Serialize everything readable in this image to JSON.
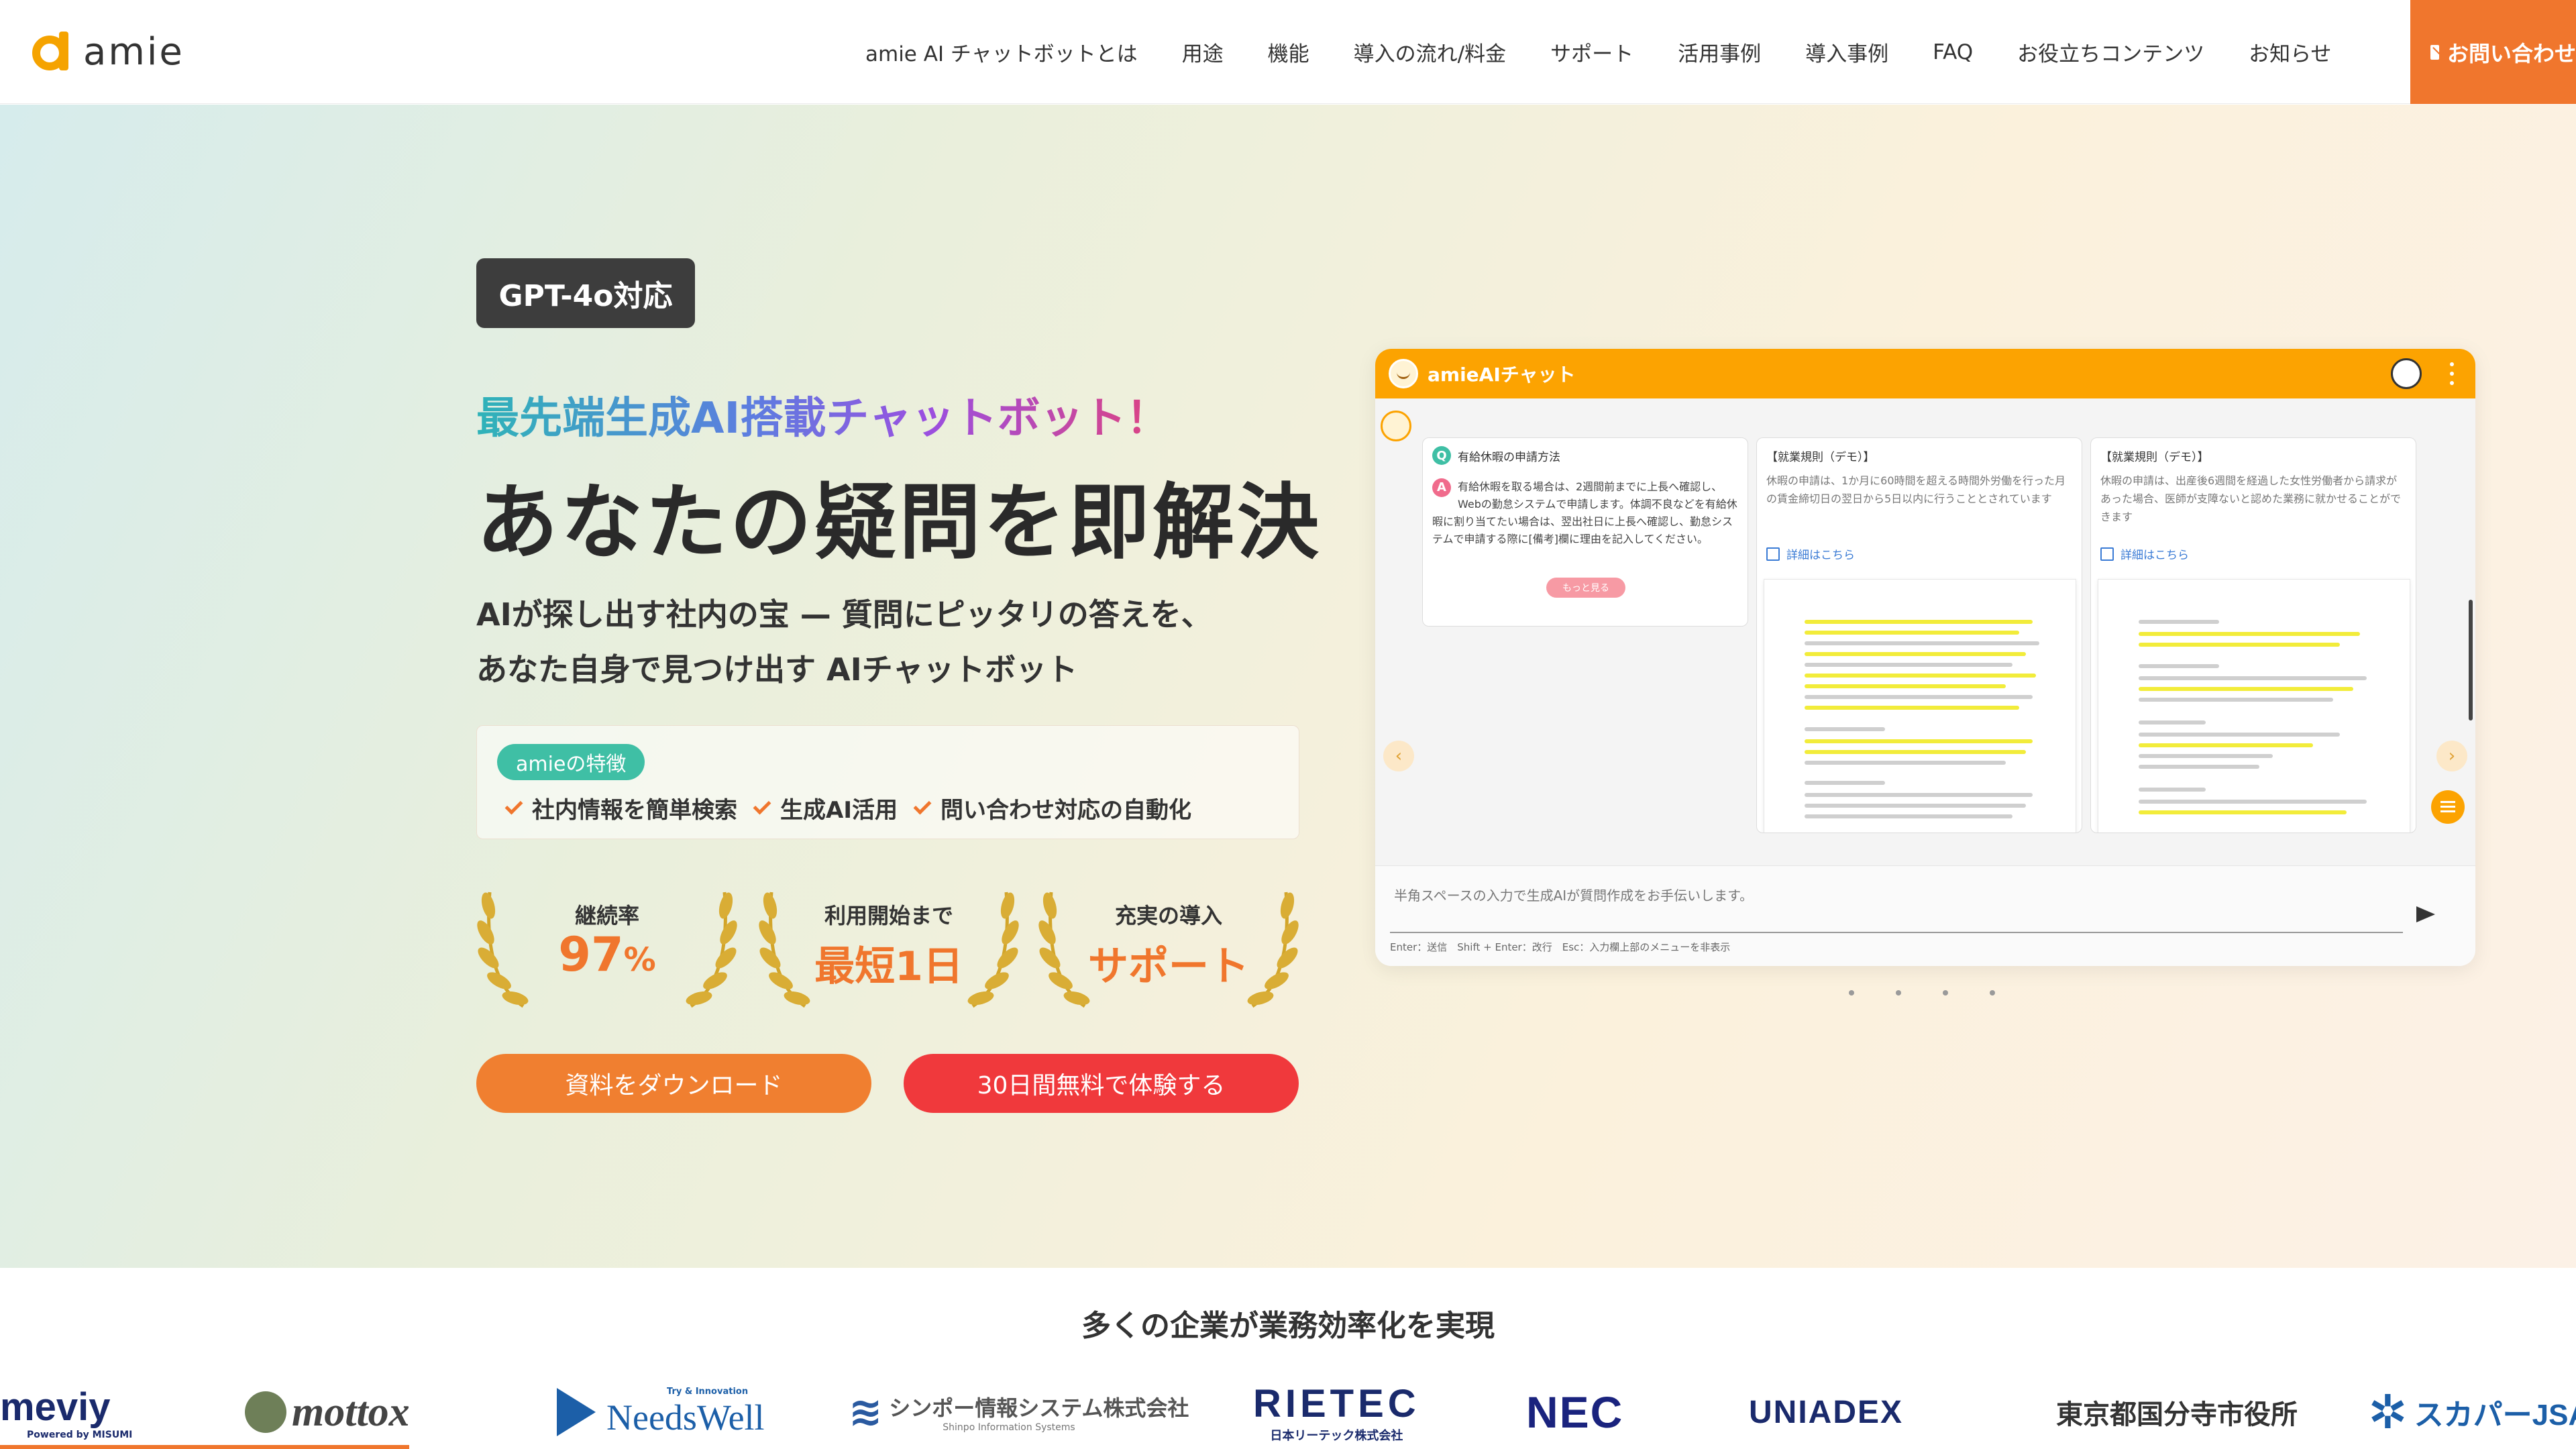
{
  "header": {
    "logo_text": "amie",
    "nav": [
      "amie AI チャットボットとは",
      "用途",
      "機能",
      "導入の流れ/料金",
      "サポート",
      "活用事例",
      "導入事例",
      "FAQ",
      "お役立ちコンテンツ",
      "お知らせ"
    ],
    "contact_label": "お問い合わせ"
  },
  "hero": {
    "badge": "GPT-4o対応",
    "sub_headline": "最先端生成AI搭載チャットボット！",
    "headline": "あなたの疑問を即解決",
    "desc1": "AIが探し出す社内の宝 — 質問にピッタリの答えを、",
    "desc2": "あなた自身で見つけ出す AIチャットボット",
    "feature_tag": "amieの特徴",
    "features": [
      "社内情報を簡単検索",
      "生成AI活用",
      "問い合わせ対応の自動化"
    ],
    "stats": [
      {
        "label": "継続率",
        "value": "97",
        "unit": "%"
      },
      {
        "label": "利用開始まで",
        "value": "最短1日",
        "unit": ""
      },
      {
        "label": "充実の導入",
        "value": "サポート",
        "unit": ""
      }
    ],
    "cta_download": "資料をダウンロード",
    "cta_trial": "30日間無料で体験する"
  },
  "chat": {
    "title": "amieAIチャット",
    "question": "有給休暇の申請方法",
    "answer": "有給休暇を取る場合は、2週間前までに上長へ確認し、Webの勤怠システムで申請します。体調不良などを有給休暇に割り当てたい場合は、翌出社日に上長へ確認し、勤怠システムで申請する際に[備考]欄に理由を記入してください。",
    "more_label": "もっと見る",
    "card2_title": "【就業規則（デモ）】",
    "card2_text": "休暇の申請は、1か月に60時間を超える時間外労働を行った月の賃金締切日の翌日から5日以内に行うこととされています",
    "card3_title": "【就業規則（デモ）】",
    "card3_text": "休暇の申請は、出産後6週間を経過した女性労働者から請求があった場合、医師が支障ないと認めた業務に就かせることができます",
    "detail_link": "詳細はこちら",
    "input_placeholder": "半角スペースの入力で生成AIが質問作成をお手伝いします。",
    "input_hint": "Enter：送信　Shift + Enter：改行　Esc：入力欄上部のメニューを非表示"
  },
  "clients": {
    "title": "多くの企業が業務効率化を実現",
    "logos": [
      "meviy",
      "mottox",
      "NeedsWell",
      "シンポー情報システム株式会社",
      "RIETEC",
      "NEC",
      "UNIADEX",
      "東京都国分寺市役所",
      "スカパーJSAT"
    ],
    "meviy_sub": "Powered by MISUMI",
    "needswell_sub": "Try & Innovation",
    "shinpo_sub": "Shinpo Information Systems",
    "rietec_sub": "日本リーテック株式会社"
  },
  "colors": {
    "accent": "#f0762d",
    "brand_yellow": "#fca301",
    "cta_red": "#f0393c",
    "teal": "#3fbfa5"
  }
}
